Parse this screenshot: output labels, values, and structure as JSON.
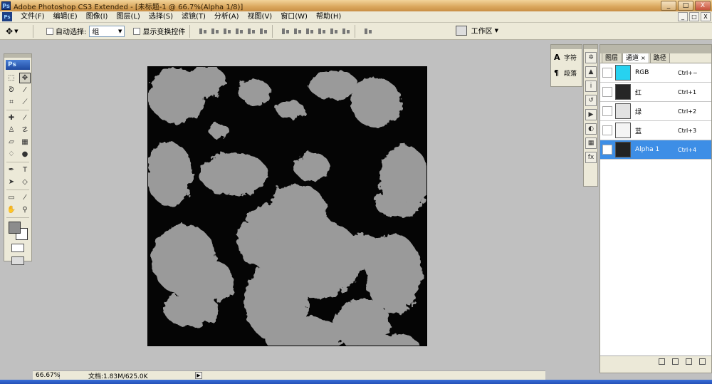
{
  "titlebar": {
    "title": "Adobe Photoshop CS3 Extended - [未标题-1 @ 66.7%(Alpha 1/8)]",
    "logo": "Ps",
    "minimize": "_",
    "maximize": "□",
    "close": "X"
  },
  "menu": {
    "items": [
      "文件(F)",
      "编辑(E)",
      "图像(I)",
      "图层(L)",
      "选择(S)",
      "滤镜(T)",
      "分析(A)",
      "视图(V)",
      "窗口(W)",
      "帮助(H)"
    ]
  },
  "options": {
    "auto_select_label": "自动选择:",
    "auto_select_value": "组",
    "show_transform_label": "显示变换控件",
    "workspace_label": "工作区"
  },
  "toolbox": {
    "badge": "Ps"
  },
  "canvas": {
    "bg_color": "#050505",
    "cloud_color": "#9a9a9a"
  },
  "status": {
    "zoom": "66.67%",
    "doc_info": "文档:1.83M/625.0K",
    "arrow": "▶"
  },
  "dock": {
    "character_label": "字符",
    "paragraph_label": "段落",
    "character_glyph": "A",
    "paragraph_glyph": "¶"
  },
  "channels": {
    "tabs": [
      {
        "label": "图层",
        "active": false
      },
      {
        "label": "通道",
        "active": true,
        "close": "×"
      },
      {
        "label": "路径",
        "active": false
      }
    ],
    "rows": [
      {
        "name": "RGB",
        "shortcut": "Ctrl+~",
        "thumb": "#27d2f0",
        "selected": false
      },
      {
        "name": "红",
        "shortcut": "Ctrl+1",
        "thumb": "#262626",
        "selected": false
      },
      {
        "name": "绿",
        "shortcut": "Ctrl+2",
        "thumb": "#e2e2e2",
        "selected": false
      },
      {
        "name": "蓝",
        "shortcut": "Ctrl+3",
        "thumb": "#f4f4f4",
        "selected": false
      },
      {
        "name": "Alpha 1",
        "shortcut": "Ctrl+4",
        "thumb": "#222222",
        "selected": true
      }
    ],
    "eye_glyph": "👁",
    "selected_color": "#3d8ee6"
  }
}
